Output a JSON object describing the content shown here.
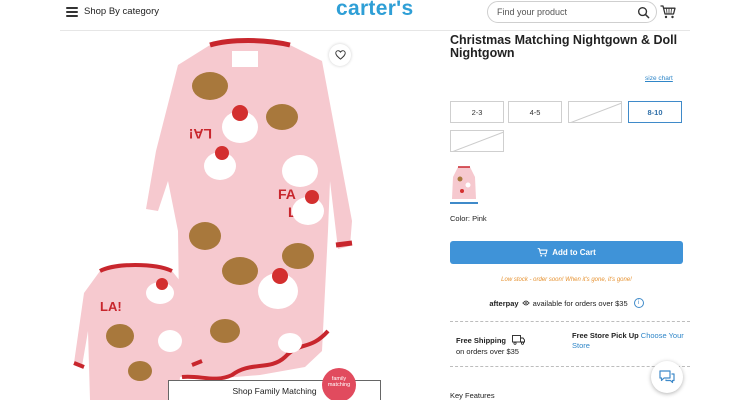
{
  "header": {
    "menu_label": "Shop By category",
    "logo_text": "carter's",
    "search_placeholder": "Find your product"
  },
  "product": {
    "title": "Christmas Matching Nightgown & Doll Nightgown",
    "size_chart_label": "size chart",
    "sizes": [
      {
        "label": "2-3",
        "state": "available"
      },
      {
        "label": "4-5",
        "state": "available"
      },
      {
        "label": "",
        "state": "unavailable"
      },
      {
        "label": "8-10",
        "state": "selected"
      },
      {
        "label": "",
        "state": "unavailable"
      }
    ],
    "color_label": "Color: Pink",
    "add_to_cart_label": "Add to Cart",
    "low_stock_text": "Low stock - order soon! When it's gone, it's gone!",
    "afterpay_brand": "afterpay",
    "afterpay_text": "available for orders over $35",
    "shipping_title": "Free Shipping",
    "shipping_sub": "on orders over $35",
    "pickup_title": "Free Store Pick Up",
    "pickup_link": "Choose Your Store",
    "key_features_label": "Key Features"
  },
  "image_overlay": {
    "shop_family_label": "Shop Family Matching",
    "family_badge": "family matching"
  },
  "colors": {
    "brand_blue": "#2f9fd6",
    "button_blue": "#3f93d8",
    "gown_pink": "#f6c9cf",
    "trim_red": "#c8262d",
    "low_stock_orange": "#e6912f"
  }
}
